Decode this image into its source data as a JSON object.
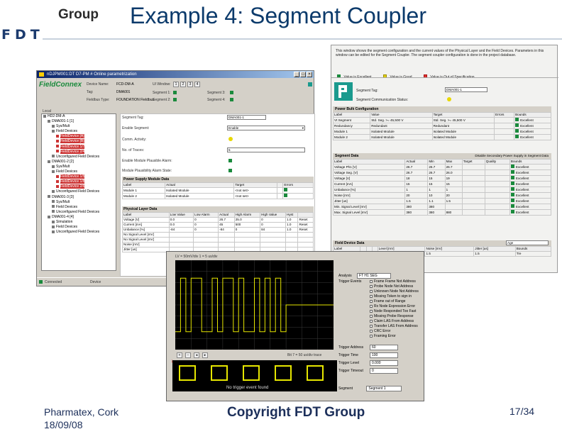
{
  "slide": {
    "brand_group": "Group",
    "brand_logo_text": "FDT",
    "title": "Example 4: Segment Coupler",
    "footer_location": "Pharmatex, Cork",
    "footer_date": "18/09/08",
    "footer_copyright": "Copyright FDT Group",
    "page": "17/34"
  },
  "colors": {
    "title": "#0b3a6b",
    "footer": "#1c2f5a",
    "fieldconnex_green": "#1a8a3c",
    "pf_teal": "#1b9a8e",
    "scope_trace": "#e6e600"
  },
  "window_a": {
    "title": "nDJPM001:DT D7-PM # Online parametrization",
    "logo": "FieldConnex",
    "header": {
      "device_name_label": "Device Name:",
      "device_name_value": "FCD-DM-A",
      "tag_label": "Tag:",
      "tag_value": "DMA001",
      "fieldbus_type_label": "Fieldbus Type:",
      "fieldbus_type_value": "FOUNDATION Fieldbus",
      "ui_window_label": "UI Window:",
      "segment_labels": [
        "Segment 1:",
        "Segment 2:",
        "Segment 3:",
        "Segment 4:"
      ],
      "tabs": [
        "1",
        "2",
        "3",
        "4"
      ]
    },
    "tree_label": "Local",
    "tree": [
      "HD2-DM-A",
      "DMA001-1 [1]",
      "Sys/Mult",
      "Field Devices",
      "FieldDevice [A]",
      "FieldDevice [B]",
      "FieldDevice 1/7",
      "FieldDevice 2/4",
      "Unconfigured Field Devices",
      "DMA001-2 [2]",
      "Sys/Mult",
      "Field Devices",
      "FieldDevice 1/5",
      "FieldDevice 1/8",
      "FieldDevice 2/6",
      "Unconfigured Field Devices",
      "DMA001-3 [3]",
      "Sys/Mult",
      "Field Devices",
      "Unconfigured Field Devices",
      "DMA001-4 [4]",
      "Simulation",
      "Field Devices",
      "Unconfigured Field Devices"
    ],
    "form": {
      "segment_tag_label": "Segment Tag:",
      "segment_tag_value": "DMA001-1",
      "enable_segment_label": "Enable Segment:",
      "enable_segment_value": "Enable",
      "comm_label": "Comm. Activity:",
      "no_of_traces_label": "No. of Traces:",
      "no_of_traces_value": "5",
      "enable_module_label": "Enable Module Plausible Alarm:",
      "module_plausibility_label": "Module Plausibility Alarm State:",
      "psu_section": "Power Supply Module Data",
      "psu_headers": [
        "Label",
        "Actual",
        "Target",
        "",
        "Errors"
      ],
      "psu_rows": [
        [
          "Module 1",
          "Isolated Module",
          "<not set>"
        ],
        [
          "Module 2",
          "Isolated Module",
          "<not set>"
        ]
      ],
      "pl_section": "Physical Layer Data",
      "pl_headers": [
        "Label",
        "Low Value",
        "Low Alarm",
        "Actual",
        "High Alarm",
        "High Value",
        "Hyst",
        ""
      ],
      "pl_rows": [
        [
          "Voltage [V]",
          "0.0",
          "0",
          "26.7",
          "25.0",
          "0",
          "1.0",
          "Reset"
        ],
        [
          "Current [mA]",
          "0.0",
          "0",
          "45",
          "500",
          "0",
          "1.0",
          "Reset"
        ],
        [
          "Unbalance [%]",
          "-84",
          "0",
          "-84",
          "0",
          "84",
          "1.0",
          "Reset"
        ],
        [
          "No Signal Level [mV]",
          "",
          "",
          "",
          "",
          "",
          "",
          ""
        ],
        [
          "No Signal Level [mV]",
          "",
          "",
          "",
          "",
          "",
          "",
          ""
        ],
        [
          "Noise [mV]",
          "",
          "",
          "",
          "",
          "",
          "",
          ""
        ],
        [
          "Jitter [us]",
          "",
          "",
          "",
          "",
          "",
          "",
          ""
        ]
      ]
    },
    "status": {
      "left": "Connected",
      "right": "Device"
    }
  },
  "window_b": {
    "intro": "This window shows the segment configuration and the current values of the Physical Layer and the Field Devices. Parameters in this window can be edited for the Segment Coupler. The segment coupler configuration is done in the project database.",
    "legend": [
      "Value is Excellent",
      "Value is Good",
      "Value is Out of Specification"
    ],
    "segment_tag_label": "Segment Tag:",
    "segment_tag_value": "DMA001-1",
    "segment_comm_label": "Segment Communication Status:",
    "psu_config_section": "Power Bulk Configuration",
    "psu_config_headers": [
      "Label",
      "Value",
      "Target",
      "Errors",
      "Bounds"
    ],
    "psu_config_rows": [
      [
        "Vt Segment",
        "Std. Seg. >= 45,500 V",
        "Std. Seg. >= 45,500 V",
        "",
        "Excellent"
      ],
      [
        "Redundancy",
        "Redundant",
        "Redundant",
        "",
        "Excellent"
      ],
      [
        "Module 1",
        "Isolated Module",
        "Isolated Module",
        "",
        "Excellent"
      ],
      [
        "Module 2",
        "Isolated Module",
        "Isolated Module",
        "",
        "Excellent"
      ]
    ],
    "segment_data_section": "Segment Data",
    "segment_data_note": "Disable Secondary Power Supply in Segment Data",
    "segment_data_headers": [
      "Label",
      "Actual",
      "Min",
      "Max",
      "Target",
      "Quality",
      "Bounds"
    ],
    "segment_data_rows": [
      [
        "Voltage Ph1 [V]",
        "26.7",
        "26.7",
        "26.7",
        "",
        "",
        "Excellent"
      ],
      [
        "Voltage Seg. [V]",
        "26.7",
        "26.7",
        "26.0",
        "",
        "",
        "Excellent"
      ],
      [
        "Voltage [V]",
        "18",
        "15",
        "19",
        "",
        "",
        "Excellent"
      ],
      [
        "Current [mA]",
        "15",
        "15",
        "15",
        "",
        "",
        "Excellent"
      ],
      [
        "Unbalance [%]",
        "1",
        "1",
        "1",
        "",
        "",
        "Excellent"
      ],
      [
        "Noise [mV]",
        "20",
        "10",
        "20",
        "",
        "",
        "Excellent"
      ],
      [
        "Jitter [us]",
        "1.5",
        "1.1",
        "1.5",
        "",
        "",
        "Excellent"
      ],
      [
        "Min. Signal Level [mV]",
        "380",
        "380",
        "",
        "",
        "",
        "Excellent"
      ],
      [
        "Max. Signal Level [mV]",
        "380",
        "380",
        "880",
        "",
        "",
        "Excellent"
      ]
    ],
    "field_device_section": "Field Device Data",
    "field_device_select": "Age",
    "field_device_headers": [
      "Label",
      "",
      "",
      "",
      "Level [mV]",
      "Noise [mV]",
      "Jitter [us]",
      "Bounds"
    ],
    "field_device_rows": [
      [
        "5",
        "",
        "",
        "",
        "380",
        "1.5",
        "1.5",
        "Tre"
      ]
    ]
  },
  "scope": {
    "title": "LV = 50mV/div 1 = 5 us/div",
    "bottom_readout": "Bit 7 = 50 us/div trace",
    "bottom_caption": "No trigger event found",
    "analysis_label": "Analysis",
    "analysis_value": "FT H1 SEG",
    "trigger_events_label": "Trigger Events",
    "trigger_options": [
      "Frame Frame Not Address",
      "Probe Node Not Address",
      "Unknown Node Not Address",
      "Missing Token to sign in",
      "Frame out of Range",
      "Rx Node Expression Error",
      "Node Responded Too Fast",
      "Missing Probe Response",
      "Claim LAS From Address",
      "Transfer LAS From Address",
      "CRC Error",
      "Framing Error"
    ],
    "trigger_address_label": "Trigger Address",
    "trigger_address_value": "60",
    "trigger_time_label": "Trigger Time",
    "trigger_time_value": "100",
    "trigger_level_label": "Trigger Level",
    "trigger_level_value": "0.000",
    "trigger_timeout_label": "Trigger Timeout",
    "trigger_timeout_value": "0",
    "segment_label": "Segment",
    "segment_value": "Segment 1",
    "waveform": [
      0.2,
      0.8,
      0.2,
      0.8,
      0.8,
      0.2,
      0.2,
      0.8,
      0.2,
      0.8,
      0.8,
      0.2,
      0.8,
      0.2,
      0.2,
      0.8,
      0.2,
      0.8,
      0.2,
      0.8,
      0.2,
      0.5,
      0.5,
      0.5,
      0.5,
      0.5,
      0.5,
      0.5,
      0.5,
      0.5
    ]
  }
}
